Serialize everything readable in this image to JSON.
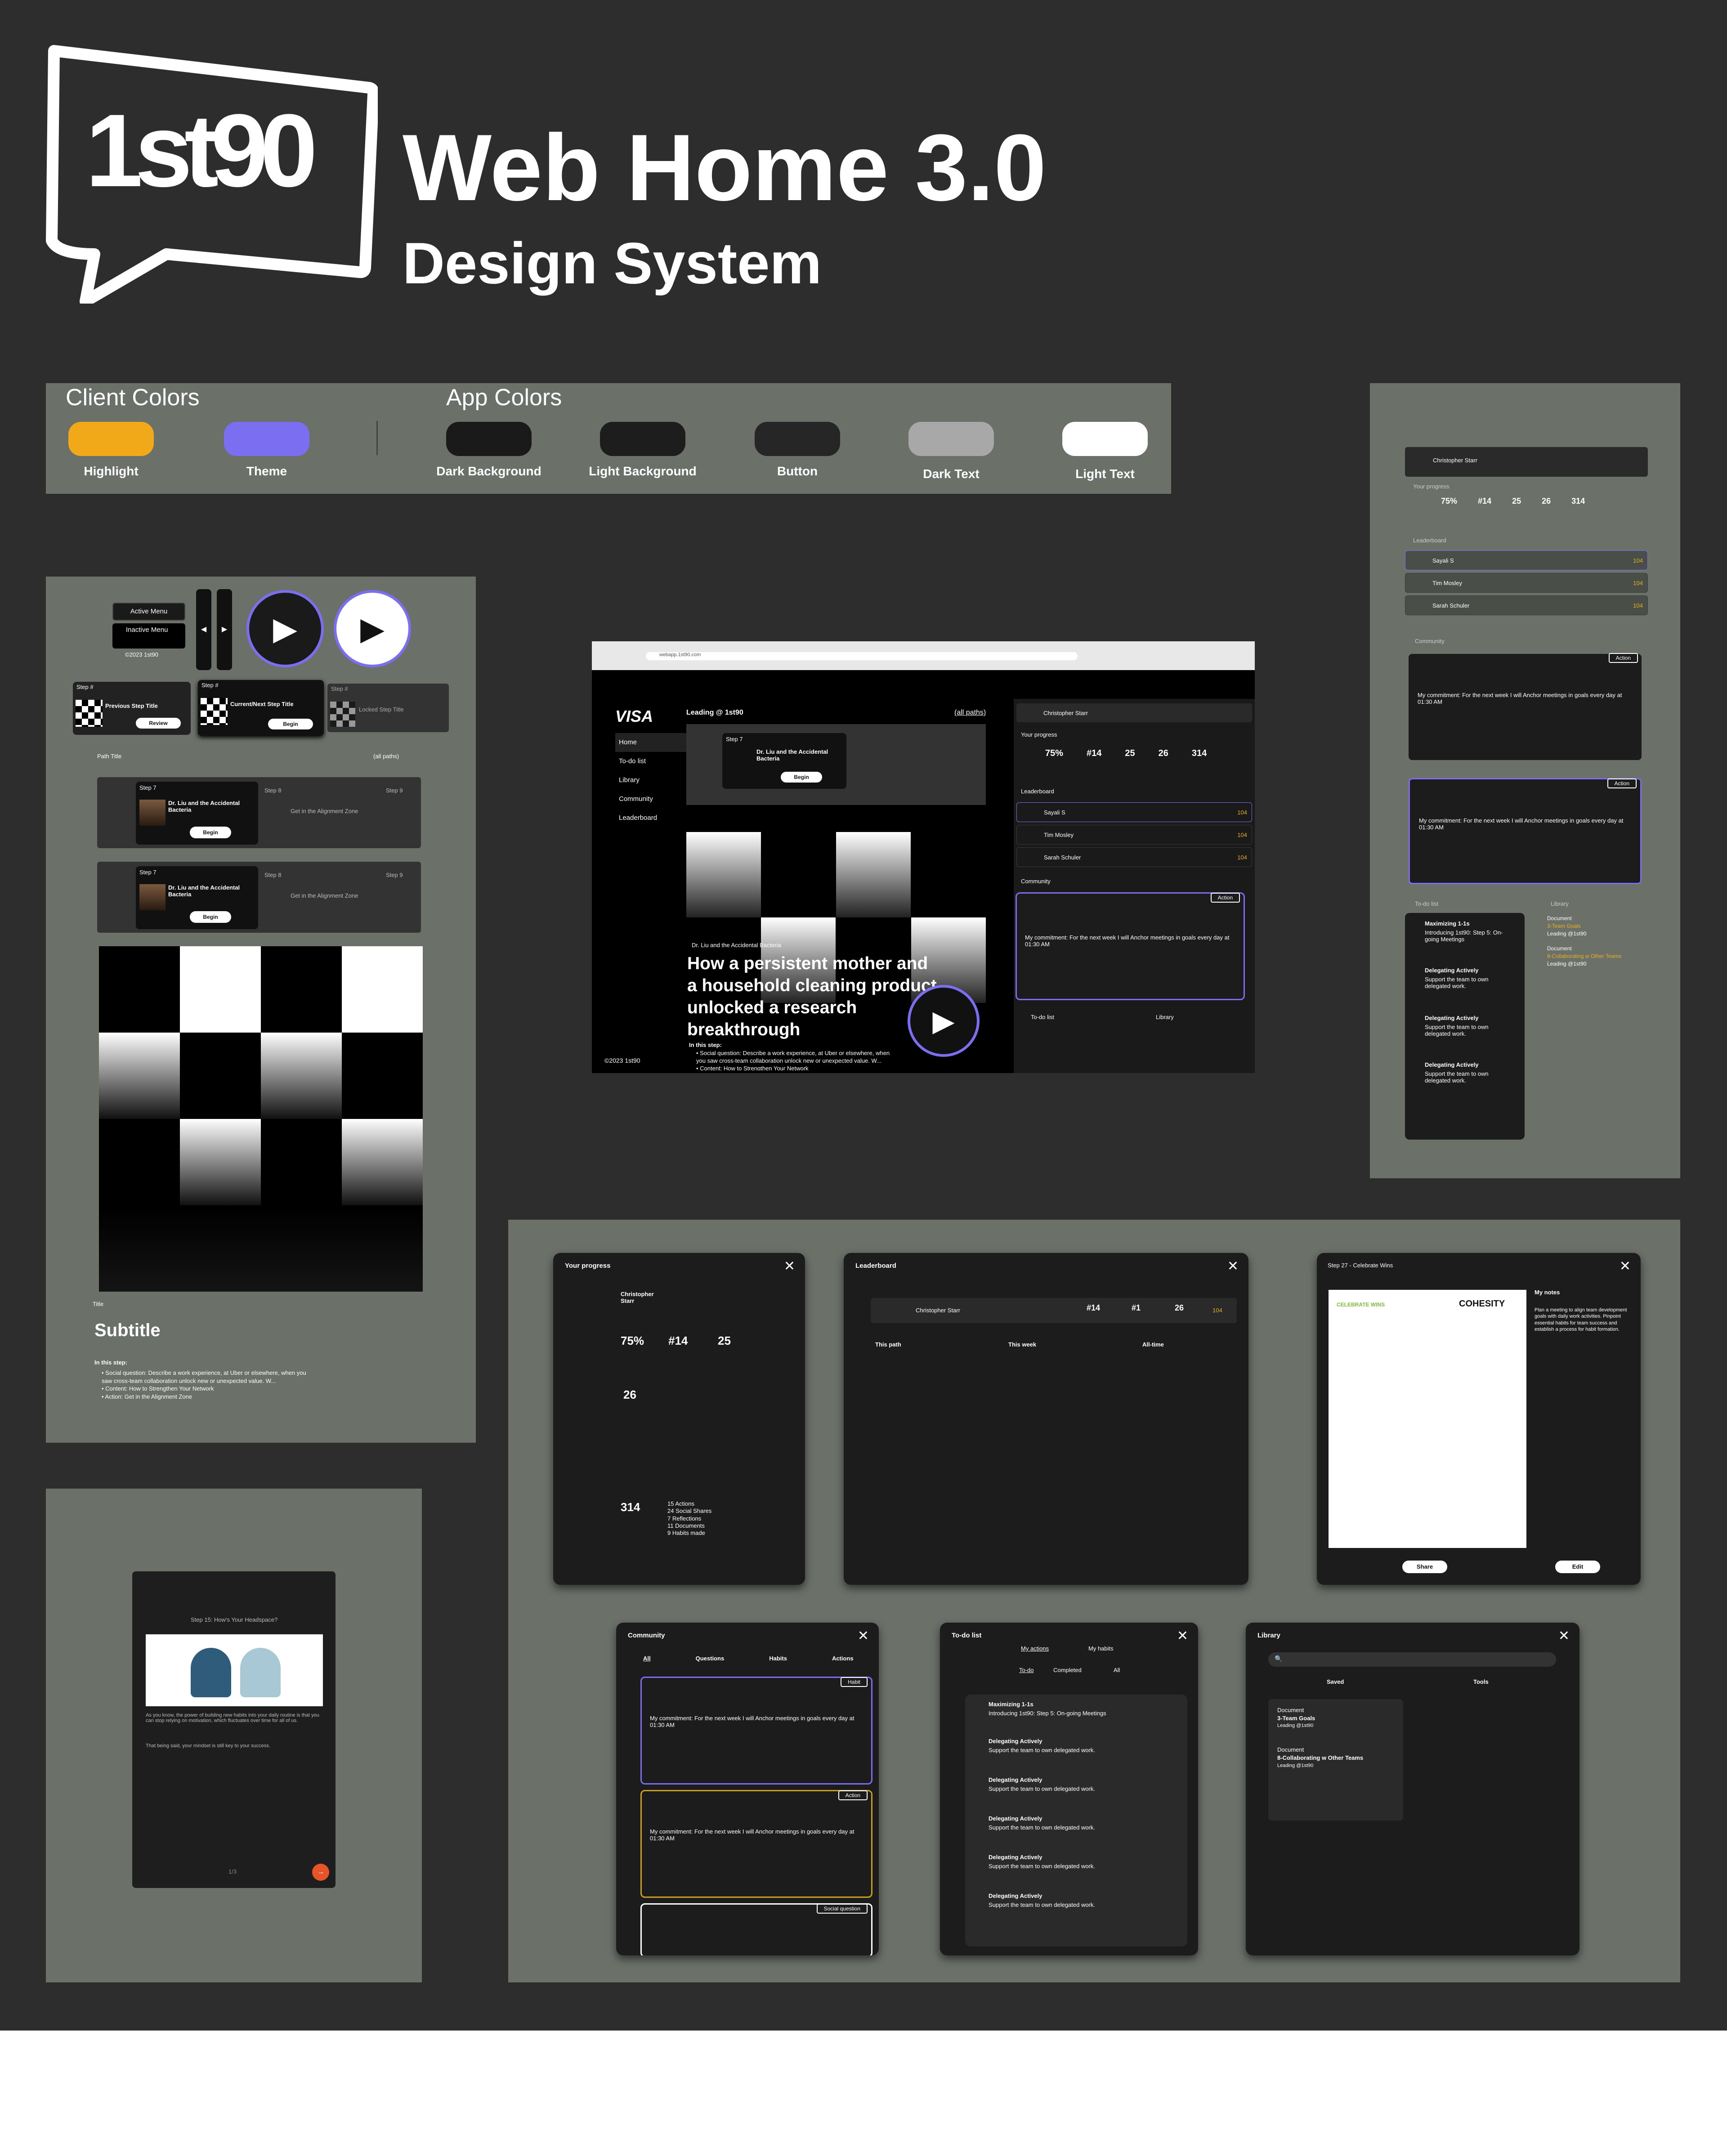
{
  "header": {
    "logo_text": "1st90",
    "title": "Web Home 3.0",
    "subtitle": "Design System"
  },
  "colors": {
    "client_heading": "Client Colors",
    "app_heading": "App Colors",
    "highlight": "Highlight",
    "theme": "Theme",
    "dark_bg": "Dark Background",
    "light_bg": "Light Background",
    "button": "Button",
    "dark_text": "Dark Text",
    "light_text": "Light Text",
    "values": {
      "highlight": "#f1a919",
      "theme": "#7b6ef0",
      "dark_background": "#1a1a1a",
      "light_background": "#1d1d1d",
      "button": "#262626",
      "dark_text": "#a8a8a8",
      "light_text": "#ffffff"
    }
  },
  "components": {
    "active_menu": "Active Menu",
    "inactive_menu": "Inactive Menu",
    "copyright": "©2023 1st90",
    "step_num": "Step #",
    "previous_step": "Previous Step Title",
    "current_step": "Current/Next Step Title",
    "locked_step": "Locked Step Title",
    "review": "Review",
    "begin": "Begin",
    "path_title": "Path Title",
    "all_paths": "(all paths)",
    "step7": "Step 7",
    "step7_title": "Dr. Liu and the Accidental Bacteria",
    "step8": "Step 8",
    "step8_title": "Get in the Alignment Zone",
    "step9": "Step 9",
    "title_label": "Title",
    "subtitle_label": "Subtitle",
    "in_this_step": "In this step:",
    "bullet1": "• Social question: Describe a work experience, at Uber or elsewhere, when you saw cross-team collaboration unlock new or unexpected value. W...",
    "bullet2": "• Content: How to Strengthen Your Network",
    "bullet3": "• Action: Get in the Alignment Zone"
  },
  "browser": {
    "url": "webapp.1st90.com",
    "client_logo": "VISA",
    "nav": [
      "Home",
      "To-do list",
      "Library",
      "Community",
      "Leaderboard"
    ],
    "leading": "Leading @ 1st90",
    "all_paths": "(all paths)",
    "hero_kicker": "Dr. Liu and the Accidental Bacteria",
    "hero_title": "How a persistent mother and a household cleaning product unlocked a research breakthrough"
  },
  "user": {
    "name": "Christopher Starr"
  },
  "progress": {
    "heading": "Your progress",
    "percent": "75%",
    "rank": "#14",
    "points": "25",
    "minutes": "26",
    "moments": "314",
    "breakdown": [
      "15 Actions",
      "24 Social Shares",
      "7 Reflections",
      "11 Documents",
      "9 Habits made"
    ]
  },
  "leaderboard": {
    "heading": "Leaderboard",
    "week_rank": "#1",
    "alltime": "26",
    "tabs": [
      "This path",
      "This week",
      "All-time"
    ],
    "rows": [
      {
        "name": "Sayali S",
        "points": "104"
      },
      {
        "name": "Tim Mosley",
        "points": "104"
      },
      {
        "name": "Sarah Schuler",
        "points": "104"
      }
    ]
  },
  "community": {
    "heading": "Community",
    "tabs": [
      "All",
      "Questions",
      "Habits",
      "Actions"
    ],
    "tag_action": "Action",
    "tag_habit": "Habit",
    "tag_social": "Social question",
    "commitment": "My commitment: For the next week I will Anchor meetings in goals every day at 01:30 AM"
  },
  "todo": {
    "heading": "To-do list",
    "tabs": [
      "My actions",
      "My habits"
    ],
    "filters": [
      "To-do",
      "Completed",
      "All"
    ],
    "items": [
      {
        "category": "Maximizing 1-1s",
        "text": "Introducing 1st90: Step 5: On-going Meetings"
      },
      {
        "category": "Delegating Actively",
        "text": "Support the team to own delegated work."
      }
    ]
  },
  "library": {
    "heading": "Library",
    "saved_tab": "Saved",
    "tools_tab": "Tools",
    "doc_label": "Document",
    "saved": [
      {
        "title": "3-Team Goals",
        "leading": "Leading @1st90"
      },
      {
        "title": "8-Collaborating w Other Teams",
        "leading": "Leading @1st90"
      }
    ]
  },
  "step27": {
    "title": "Step 27 - Celebrate Wins",
    "doc_heading": "CELEBRATE WINS",
    "doc_brand": "COHESITY",
    "notes_heading": "My notes",
    "notes": "Plan a meeting to align team development goals with daily work activities. Pinpoint essential habits for team success and establish a process for habit formation.",
    "share": "Share",
    "edit": "Edit"
  },
  "mobile": {
    "step_title": "Step 15: How's Your Headspace?",
    "body": "As you know, the power of building new habits into your daily routine is that you can stop relying on motivation, which fluctuates over time for all of us.",
    "body2": "That being said, your mindset is still key to your success.",
    "page": "1/3"
  }
}
